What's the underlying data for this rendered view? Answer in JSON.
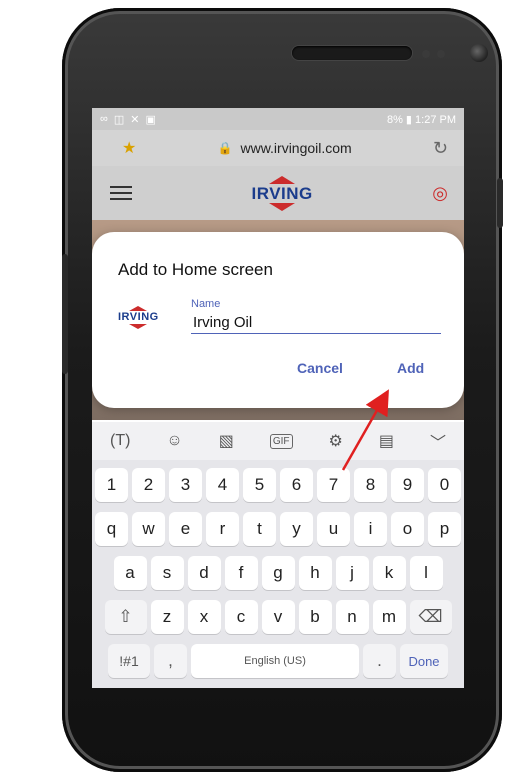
{
  "status_bar": {
    "left_icons": [
      "∞",
      "◫",
      "✕",
      "▣"
    ],
    "right_text": "8% ▮ 1:27 PM"
  },
  "browser": {
    "url": "www.irvingoil.com",
    "reload_icon": "reload-icon"
  },
  "site": {
    "logo_text": "IRVING",
    "pin_icon": "location-pin-icon"
  },
  "dialog": {
    "title": "Add to Home screen",
    "logo_text": "IRVING",
    "field_label": "Name",
    "field_value": "Irving Oil",
    "cancel_label": "Cancel",
    "add_label": "Add"
  },
  "keyboard": {
    "toolbar_icons": [
      "(T)",
      "☺",
      "▧",
      "GIF",
      "⚙",
      "▤",
      "﹀"
    ],
    "row_numbers": [
      "1",
      "2",
      "3",
      "4",
      "5",
      "6",
      "7",
      "8",
      "9",
      "0"
    ],
    "row_qwerty": [
      "q",
      "w",
      "e",
      "r",
      "t",
      "y",
      "u",
      "i",
      "o",
      "p"
    ],
    "row_asdf": [
      "a",
      "s",
      "d",
      "f",
      "g",
      "h",
      "j",
      "k",
      "l"
    ],
    "row_zxcv": [
      "z",
      "x",
      "c",
      "v",
      "b",
      "n",
      "m"
    ],
    "shift_icon": "⇧",
    "backspace_icon": "⌫",
    "symbols_label": "!#1",
    "comma_label": ",",
    "space_label": "English (US)",
    "period_label": ".",
    "done_label": "Done"
  },
  "colors": {
    "accent": "#4f63b8",
    "brand_red": "#cc2c2c",
    "brand_blue": "#1b3c8c",
    "arrow": "#e02020"
  }
}
